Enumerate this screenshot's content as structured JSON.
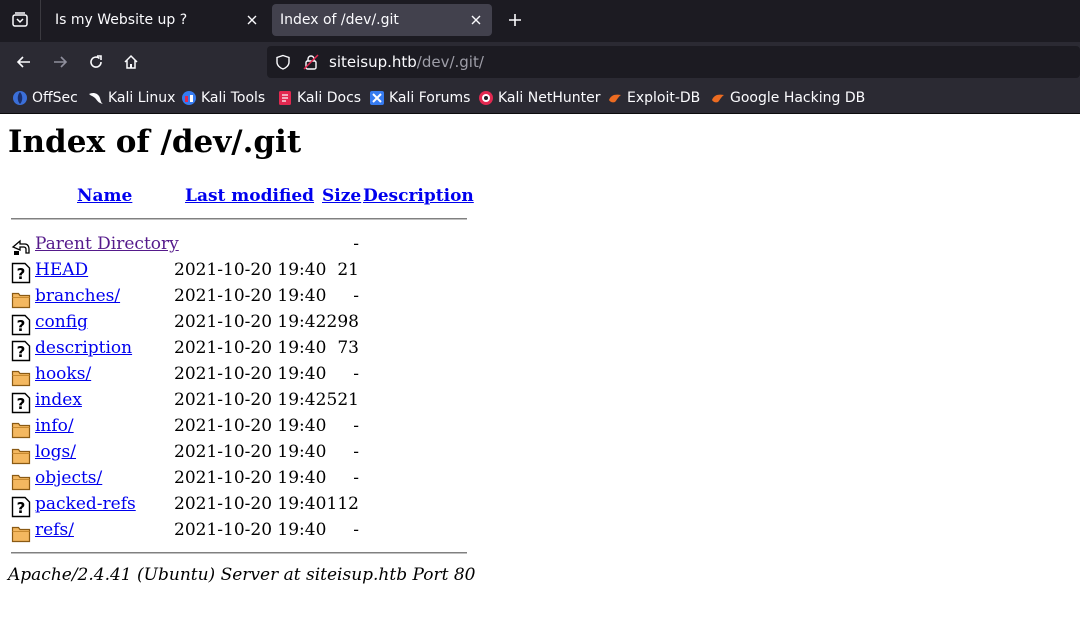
{
  "browser": {
    "tabs": [
      {
        "title": "Is my Website up ?",
        "active": false
      },
      {
        "title": "Index of /dev/.git",
        "active": true
      }
    ],
    "url": {
      "host": "siteisup.htb",
      "path": "/dev/.git/"
    },
    "bookmarks": [
      {
        "label": "OffSec",
        "icon": "offsec-icon"
      },
      {
        "label": "Kali Linux",
        "icon": "kali-dragon-icon"
      },
      {
        "label": "Kali Tools",
        "icon": "kali-tools-icon"
      },
      {
        "label": "Kali Docs",
        "icon": "kali-docs-icon"
      },
      {
        "label": "Kali Forums",
        "icon": "kali-forums-icon"
      },
      {
        "label": "Kali NetHunter",
        "icon": "kali-nethunter-icon"
      },
      {
        "label": "Exploit-DB",
        "icon": "exploit-db-icon"
      },
      {
        "label": "Google Hacking DB",
        "icon": "exploit-db-icon"
      }
    ]
  },
  "page": {
    "title": "Index of /dev/.git",
    "columns": {
      "name": "Name",
      "last_modified": "Last modified",
      "size": "Size",
      "description": "Description"
    },
    "rows": [
      {
        "name": "Parent Directory",
        "date": "",
        "size": "-",
        "icon": "back-icon"
      },
      {
        "name": "HEAD",
        "date": "2021-10-20 19:40",
        "size": "21",
        "icon": "unknown-file-icon"
      },
      {
        "name": "branches/",
        "date": "2021-10-20 19:40",
        "size": "-",
        "icon": "folder-icon"
      },
      {
        "name": "config",
        "date": "2021-10-20 19:42",
        "size": "298",
        "icon": "unknown-file-icon"
      },
      {
        "name": "description",
        "date": "2021-10-20 19:40",
        "size": "73",
        "icon": "unknown-file-icon"
      },
      {
        "name": "hooks/",
        "date": "2021-10-20 19:40",
        "size": "-",
        "icon": "folder-icon"
      },
      {
        "name": "index",
        "date": "2021-10-20 19:42",
        "size": "521",
        "icon": "unknown-file-icon"
      },
      {
        "name": "info/",
        "date": "2021-10-20 19:40",
        "size": "-",
        "icon": "folder-icon"
      },
      {
        "name": "logs/",
        "date": "2021-10-20 19:40",
        "size": "-",
        "icon": "folder-icon"
      },
      {
        "name": "objects/",
        "date": "2021-10-20 19:40",
        "size": "-",
        "icon": "folder-icon"
      },
      {
        "name": "packed-refs",
        "date": "2021-10-20 19:40",
        "size": "112",
        "icon": "unknown-file-icon"
      },
      {
        "name": "refs/",
        "date": "2021-10-20 19:40",
        "size": "-",
        "icon": "folder-icon"
      }
    ],
    "footer": "Apache/2.4.41 (Ubuntu) Server at siteisup.htb Port 80"
  },
  "colors": {
    "link": "#0000ee",
    "visited": "#551a8b",
    "chrome_dark": "#1c1b22",
    "chrome": "#2b2a33"
  }
}
